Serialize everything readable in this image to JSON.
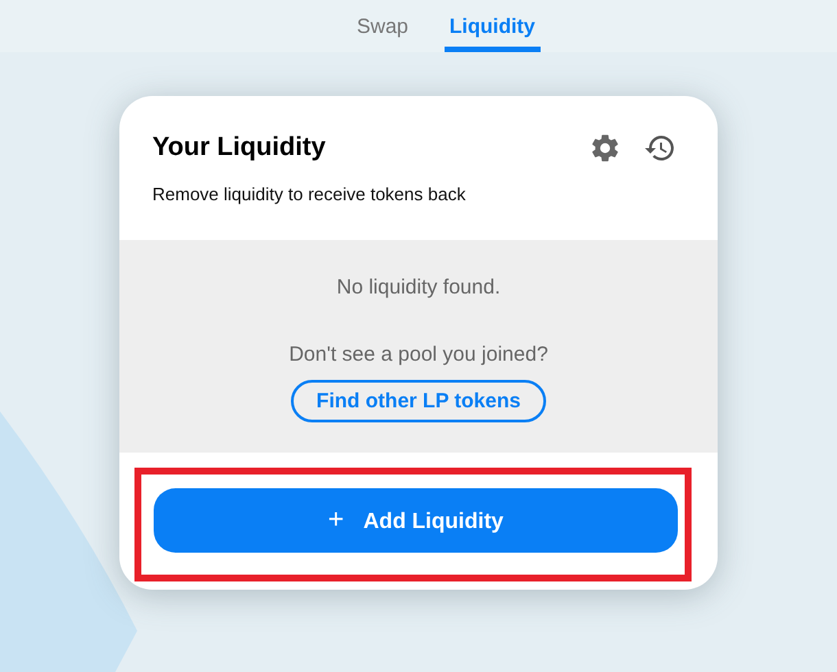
{
  "tabs": [
    {
      "label": "Swap",
      "selected": false
    },
    {
      "label": "Liquidity",
      "selected": true
    }
  ],
  "card": {
    "title": "Your Liquidity",
    "subtitle": "Remove liquidity to receive tokens back",
    "empty_message": "No liquidity found.",
    "prompt": "Don't see a pool you joined?",
    "find_button": "Find other LP tokens",
    "add_button": {
      "icon": "+",
      "label": "Add Liquidity",
      "highlighted": true
    }
  }
}
